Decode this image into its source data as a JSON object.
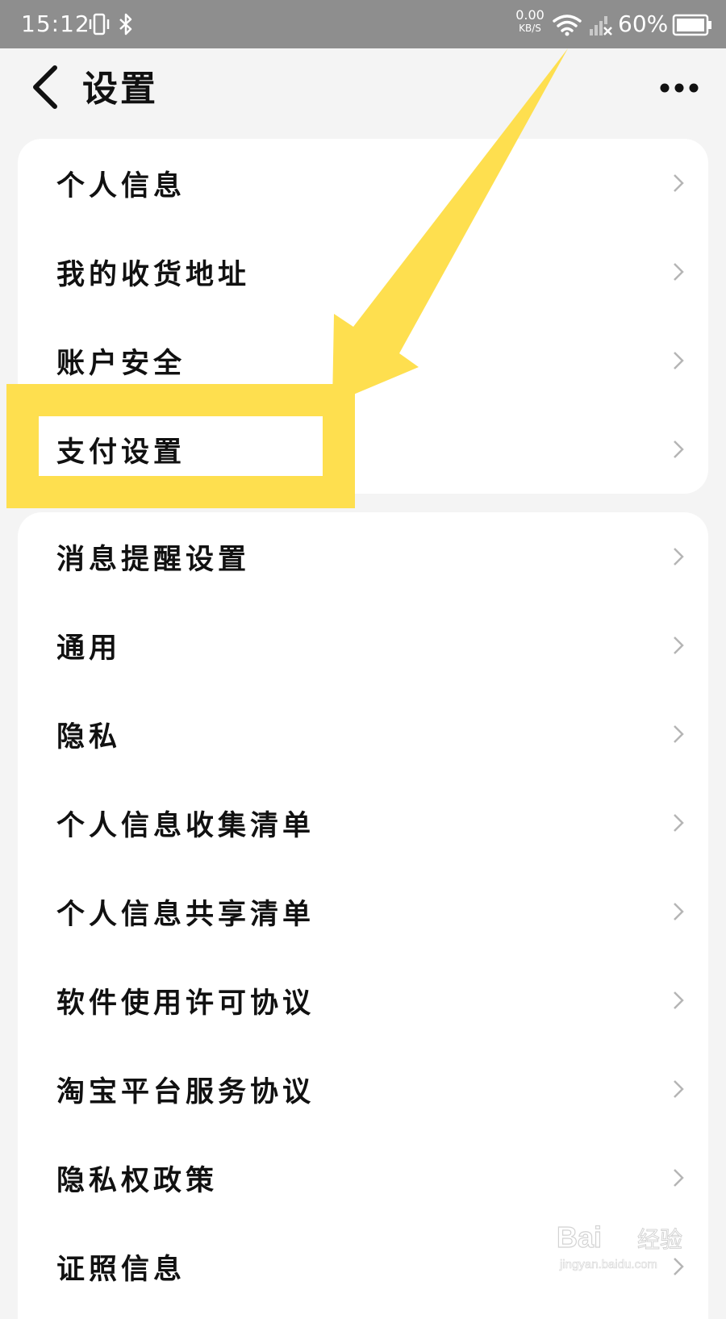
{
  "status_bar": {
    "time": "15:12",
    "net_speed_value": "0.00",
    "net_speed_unit": "KB/S",
    "battery_percent": "60%",
    "icons": [
      "vibrate-icon",
      "bluetooth-icon",
      "wifi-icon",
      "signal-no-service-icon",
      "battery-icon"
    ]
  },
  "nav": {
    "title": "设置",
    "back_icon": "chevron-left-icon",
    "more_icon": "more-dots-icon"
  },
  "sections": [
    {
      "items": [
        {
          "label": "个人信息"
        },
        {
          "label": "我的收货地址"
        },
        {
          "label": "账户安全"
        },
        {
          "label": "支付设置"
        }
      ]
    },
    {
      "items": [
        {
          "label": "消息提醒设置"
        },
        {
          "label": "通用"
        },
        {
          "label": "隐私"
        },
        {
          "label": "个人信息收集清单"
        },
        {
          "label": "个人信息共享清单"
        },
        {
          "label": "软件使用许可协议"
        },
        {
          "label": "淘宝平台服务协议"
        },
        {
          "label": "隐私权政策"
        },
        {
          "label": "证照信息"
        }
      ]
    }
  ],
  "annotation": {
    "highlighted_item": "支付设置",
    "color": "#fedf4f"
  },
  "watermark": {
    "brand": "Bai 经验",
    "url": "jingyan.baidu.com"
  },
  "colors": {
    "status_bar_bg": "#8e8e8e",
    "page_bg": "#f4f4f4",
    "card_bg": "#ffffff",
    "text": "#111111",
    "chevron": "#b5b5b5"
  }
}
